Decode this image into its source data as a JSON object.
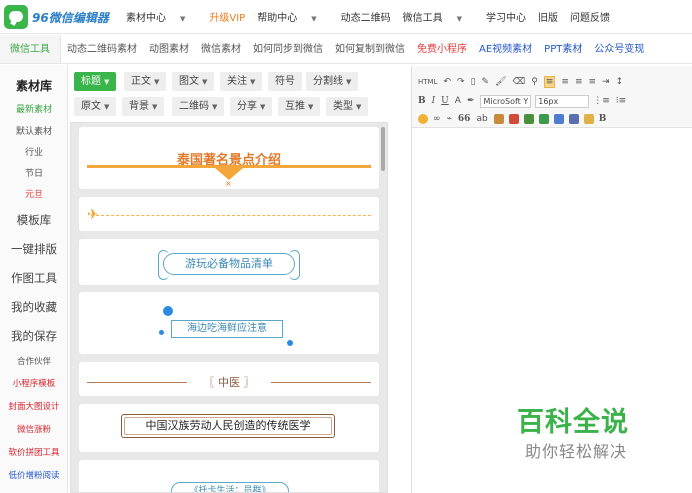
{
  "app": {
    "logo_text": "96微信编辑器"
  },
  "topnav": {
    "items": [
      {
        "label": "素材中心",
        "caret": "▼"
      },
      {
        "label": "升级VIP"
      },
      {
        "label": "帮助中心",
        "caret": "▼"
      },
      {
        "label": "动态二维码"
      },
      {
        "label": "微信工具",
        "caret": "▼"
      },
      {
        "label": "学习中心"
      },
      {
        "label": "旧版"
      },
      {
        "label": "问题反馈"
      }
    ]
  },
  "tabs": {
    "items": [
      {
        "label": "微信工具"
      },
      {
        "label": "动态二维码素材"
      },
      {
        "label": "动图素材"
      },
      {
        "label": "微信素材"
      },
      {
        "label": "如何同步到微信"
      },
      {
        "label": "如何复制到微信"
      },
      {
        "label": "免费小程序"
      },
      {
        "label": "AE视频素材"
      },
      {
        "label": "PPT素材"
      },
      {
        "label": "公众号变现"
      }
    ]
  },
  "sidebar": {
    "items": [
      {
        "label": "素材库"
      },
      {
        "label": "最新素材"
      },
      {
        "label": "默认素材"
      },
      {
        "label": "行业"
      },
      {
        "label": "节日"
      },
      {
        "label": "元旦"
      },
      {
        "label": "模板库"
      },
      {
        "label": "一键排版"
      },
      {
        "label": "作图工具"
      },
      {
        "label": "我的收藏"
      },
      {
        "label": "我的保存"
      },
      {
        "label": "合作伙伴"
      },
      {
        "label": "小程序模板"
      },
      {
        "label": "封面大图设计"
      },
      {
        "label": "微信涨粉"
      },
      {
        "label": "软价拼团工具"
      },
      {
        "label": "低价增粉阅读"
      }
    ]
  },
  "filters": {
    "items": [
      {
        "label": "标题",
        "caret": "▼"
      },
      {
        "label": "正文",
        "caret": "▼"
      },
      {
        "label": "图文",
        "caret": "▼"
      },
      {
        "label": "关注",
        "caret": "▼"
      },
      {
        "label": "符号"
      },
      {
        "label": "分割线",
        "caret": "▼"
      },
      {
        "label": "原文",
        "caret": "▼"
      },
      {
        "label": "背景",
        "caret": "▼"
      },
      {
        "label": "二维码",
        "caret": "▼"
      },
      {
        "label": "分享",
        "caret": "▼"
      },
      {
        "label": "互推",
        "caret": "▼"
      },
      {
        "label": "类型",
        "caret": "▼"
      }
    ]
  },
  "templates": {
    "items": [
      {
        "text": "泰国著名景点介绍",
        "accent": "#f4a63a"
      },
      {
        "text": ""
      },
      {
        "text": "游玩必备物品清单"
      },
      {
        "text": "海边吃海鲜应注意"
      },
      {
        "text": "〖 中医 〗"
      },
      {
        "text": "中国汉族劳动人民创造的传统医学"
      },
      {
        "text": "《托卡生活：员群》"
      }
    ]
  },
  "editor": {
    "font_select": "MicroSoft Y",
    "size_select": "16px",
    "toolbar_html_label": "HTML"
  },
  "watermark": {
    "title": "百科全说",
    "subtitle": "助你轻松解决"
  },
  "colors": {
    "brand_green": "#39b54a",
    "accent_orange": "#f07b19",
    "link_blue": "#2456c8",
    "alert_red": "#e23b3b"
  }
}
